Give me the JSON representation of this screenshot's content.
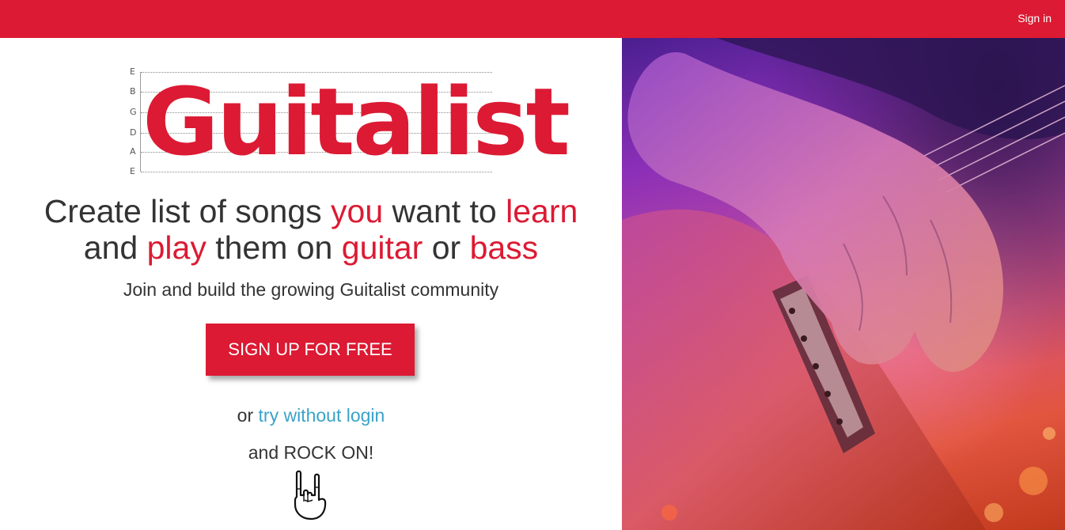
{
  "header": {
    "signin_label": "Sign in"
  },
  "logo": {
    "word": "Guitalist",
    "strings": [
      "E",
      "B",
      "G",
      "D",
      "A",
      "E"
    ]
  },
  "headline": {
    "line1": {
      "p1": "Create list of songs ",
      "h1": "you",
      "p2": " want to ",
      "h2": "learn"
    },
    "line2": {
      "p1": "and ",
      "h1": "play",
      "p2": " them on ",
      "h2": "guitar",
      "p3": " or ",
      "h3": "bass"
    }
  },
  "subline": "Join and build the growing Guitalist community",
  "signup_label": "SIGN UP FOR FREE",
  "try": {
    "prefix": "or ",
    "link": "try without login"
  },
  "rock_text": "and ROCK ON!",
  "icons": {
    "rock_hand": "rock-hand-icon"
  },
  "colors": {
    "brand_red": "#dc1a33",
    "link_blue": "#3aa3c7",
    "text_dark": "#333333"
  }
}
